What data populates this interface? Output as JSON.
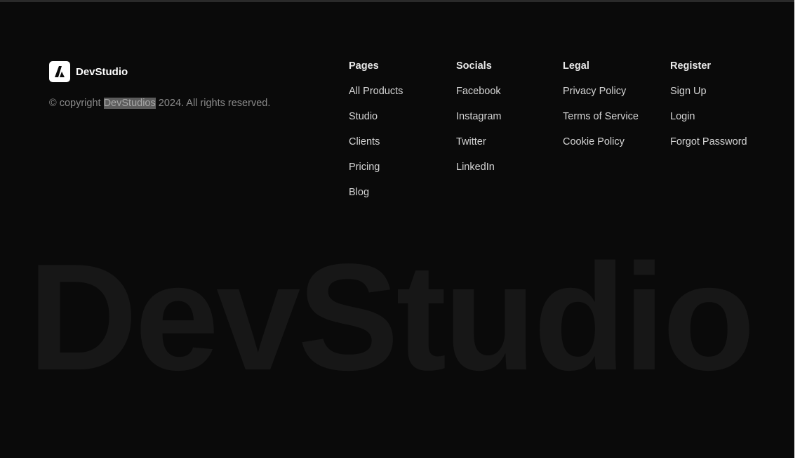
{
  "brand": {
    "name": "DevStudio",
    "logo_icon": "devstudio-logo-icon"
  },
  "copyright": {
    "prefix": "© copyright ",
    "highlighted": "DevStudios",
    "suffix": " 2024. All rights reserved."
  },
  "columns": [
    {
      "heading": "Pages",
      "links": [
        "All Products",
        "Studio",
        "Clients",
        "Pricing",
        "Blog"
      ]
    },
    {
      "heading": "Socials",
      "links": [
        "Facebook",
        "Instagram",
        "Twitter",
        "LinkedIn"
      ]
    },
    {
      "heading": "Legal",
      "links": [
        "Privacy Policy",
        "Terms of Service",
        "Cookie Policy"
      ]
    },
    {
      "heading": "Register",
      "links": [
        "Sign Up",
        "Login",
        "Forgot Password"
      ]
    }
  ],
  "watermark": "DevStudio",
  "colors": {
    "background": "#0a0a0a",
    "text": "#d4d4d4",
    "muted": "#8a8a8a",
    "watermark": "#171717",
    "logo_bg": "#ffffff"
  }
}
